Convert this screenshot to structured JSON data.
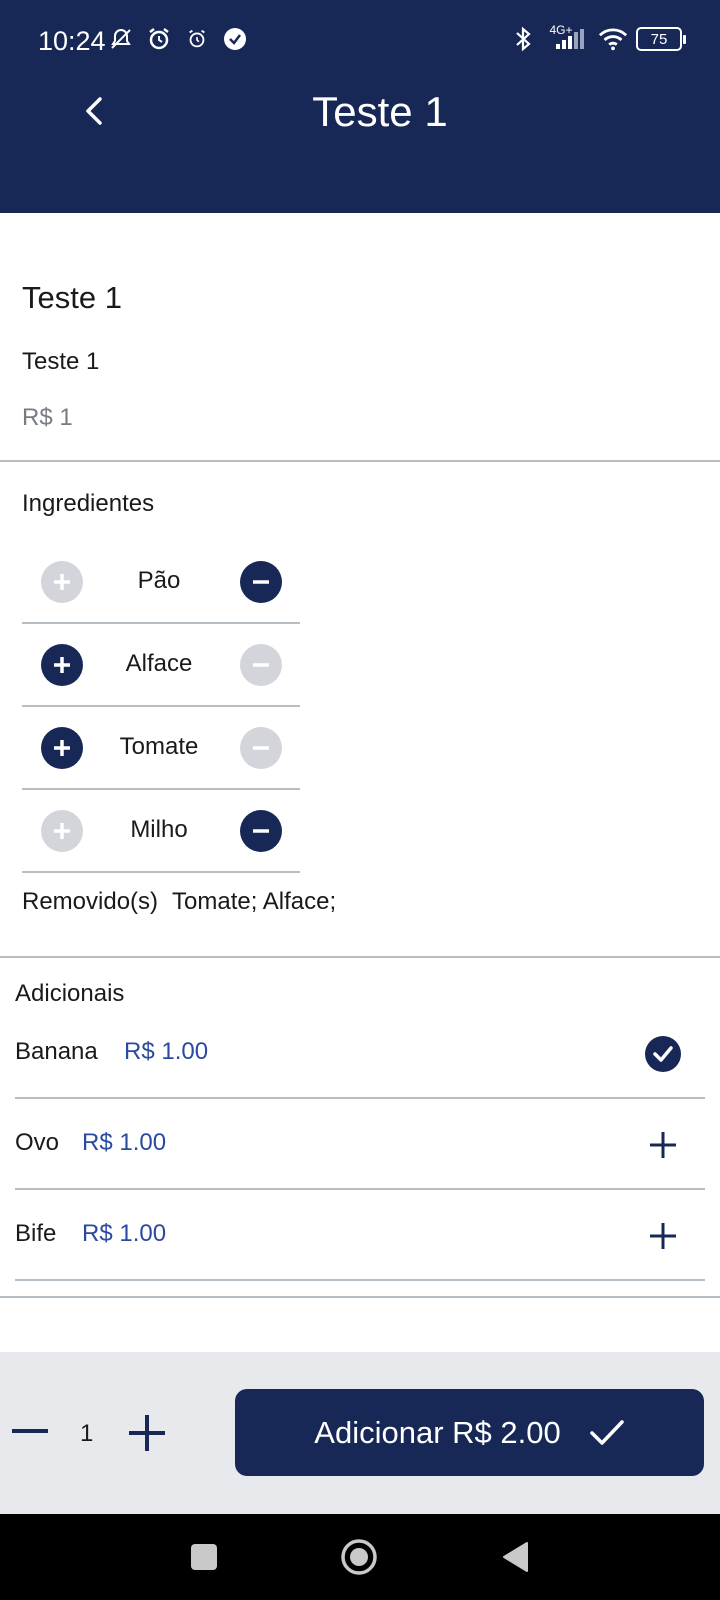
{
  "status_bar": {
    "time": "10:24",
    "network": "4G+",
    "battery": "75"
  },
  "header": {
    "title": "Teste 1"
  },
  "product": {
    "name": "Teste 1",
    "description": "Teste 1",
    "price": "R$ 1"
  },
  "ingredients": {
    "title": "Ingredientes",
    "items": [
      {
        "label": "Pão",
        "add_enabled": false,
        "remove_enabled": true
      },
      {
        "label": "Alface",
        "add_enabled": true,
        "remove_enabled": false
      },
      {
        "label": "Tomate",
        "add_enabled": true,
        "remove_enabled": false
      },
      {
        "label": "Milho",
        "add_enabled": false,
        "remove_enabled": true
      }
    ],
    "removed_label": "Removido(s)",
    "removed_value": "Tomate; Alface;"
  },
  "extras": {
    "title": "Adicionais",
    "items": [
      {
        "name": "Banana",
        "price": "R$ 1.00",
        "selected": true
      },
      {
        "name": "Ovo",
        "price": "R$ 1.00",
        "selected": false
      },
      {
        "name": "Bife",
        "price": "R$ 1.00",
        "selected": false
      }
    ]
  },
  "footer": {
    "quantity": "1",
    "add_button_label": "Adicionar R$ 2.00"
  },
  "colors": {
    "primary": "#182856",
    "disabled": "#d3d5db",
    "price_accent": "#2a4aa0",
    "divider": "#b8bfc4",
    "bottom_bar": "#e8e9ec"
  }
}
